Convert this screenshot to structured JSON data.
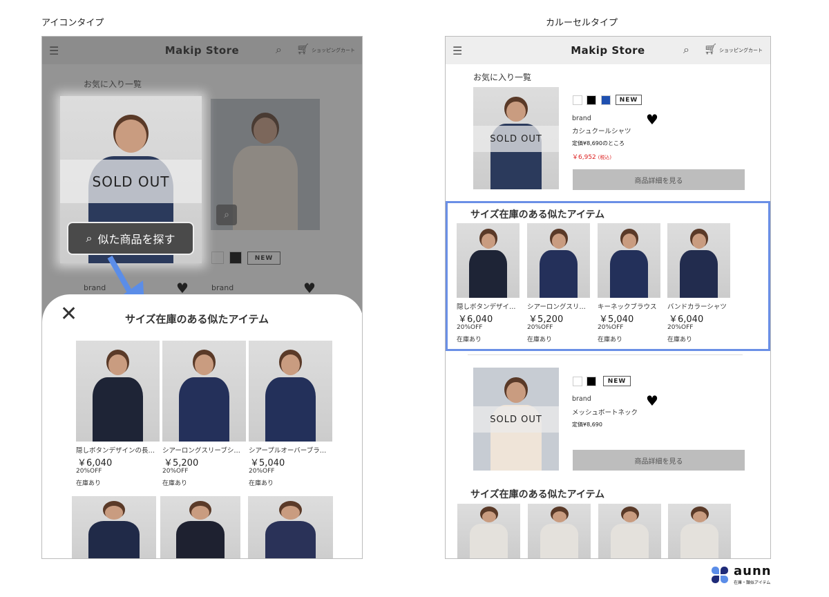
{
  "labels": {
    "left": "アイコンタイプ",
    "right": "カルーセルタイプ"
  },
  "store": {
    "title": "Makip Store",
    "cart": "ショッピングカート",
    "icons": [
      "menu-icon",
      "search-icon",
      "cart-icon"
    ]
  },
  "favorites_title": "お気に入り一覧",
  "sold_out": "SOLD OUT",
  "new_badge": "NEW",
  "brand": "brand",
  "detail_button": "商品詳細を見る",
  "similar_title": "サイズ在庫のある似たアイテム",
  "find_similar_button": "似た商品を探す",
  "accent": "#6a8fe6",
  "favorites": [
    {
      "name": "カシュクールシャツ",
      "list_price": "定価¥8,690のところ",
      "sale_price": "￥6,952",
      "tax": "(税込)",
      "swatches": [
        "#ffffff",
        "#000000",
        "#1f50b0"
      ],
      "sold_out": true
    },
    {
      "name": "メッシュボートネック",
      "list_price": "定価¥8,690",
      "swatches": [
        "#ffffff",
        "#000000"
      ],
      "sold_out": true
    }
  ],
  "sheet_items": [
    {
      "name": "隠しボタンデザインの長…",
      "price": "￥6,040",
      "off": "20%OFF",
      "stock": "在庫あり"
    },
    {
      "name": "シアーロングスリーブシ…",
      "price": "￥5,200",
      "off": "20%OFF",
      "stock": "在庫あり"
    },
    {
      "name": "シアープルオーバーブラ…",
      "price": "￥5,040",
      "off": "20%OFF",
      "stock": "在庫あり"
    }
  ],
  "carousel_items": [
    {
      "name": "隠しボタンデザイ…",
      "price": "￥6,040",
      "off": "20%OFF",
      "stock": "在庫あり"
    },
    {
      "name": "シアーロングスリ…",
      "price": "￥5,200",
      "off": "20%OFF",
      "stock": "在庫あり"
    },
    {
      "name": "キーネックブラウス",
      "price": "￥5,040",
      "off": "20%OFF",
      "stock": "在庫あり"
    },
    {
      "name": "バンドカラーシャツ",
      "price": "￥6,040",
      "off": "20%OFF",
      "stock": "在庫あり"
    }
  ],
  "logo": {
    "name": "aunn",
    "tagline": "在庫・類似アイテム"
  }
}
